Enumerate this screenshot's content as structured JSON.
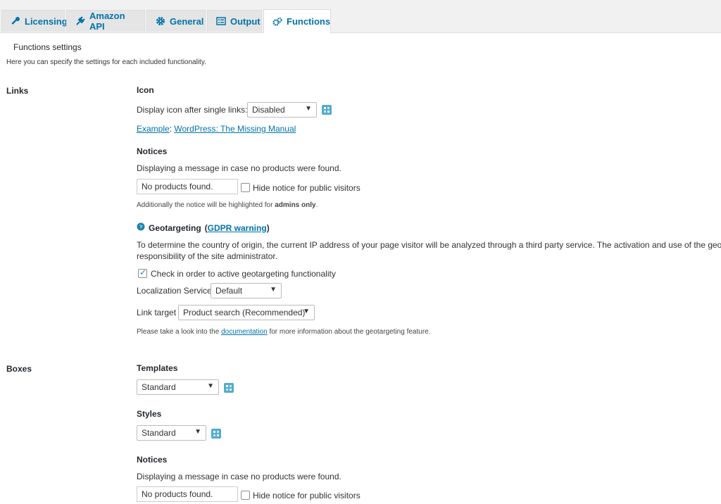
{
  "tabs": [
    {
      "label": "Licensing",
      "icon": "key-icon"
    },
    {
      "label": "Amazon API",
      "icon": "plug-icon"
    },
    {
      "label": "General",
      "icon": "gear-icon"
    },
    {
      "label": "Output",
      "icon": "list-icon"
    },
    {
      "label": "Functions",
      "icon": "gears-icon",
      "active": true
    }
  ],
  "page": {
    "heading": "Functions settings",
    "description": "Here you can specify the settings for each included functionality."
  },
  "links": {
    "section_label": "Links",
    "icon": {
      "title": "Icon",
      "display_label": "Display icon after single links:",
      "display_value": "Disabled",
      "example_label": "Example",
      "example_link": "WordPress: The Missing Manual"
    },
    "notices": {
      "title": "Notices",
      "description": "Displaying a message in case no products were found.",
      "input_value": "No products found.",
      "hide_label": "Hide notice for public visitors",
      "hide_checked": false,
      "note_prefix": "Additionally the notice will be highlighted for ",
      "note_bold": "admins only",
      "note_suffix": "."
    },
    "geotargeting": {
      "title": "Geotargeting",
      "warning_open": "(",
      "warning_link": "GDPR warning",
      "warning_close": ")",
      "description_line1": "To determine the country of origin, the current IP address of your page visitor will be analyzed through a third party service. The activation and use of the geo-ta",
      "description_line2": "responsibility of the site administrator.",
      "check_label": "Check in order to active geotargeting functionality",
      "check_checked": true,
      "service_label": "Localization Service",
      "service_value": "Default",
      "target_label": "Link target",
      "target_value": "Product search (Recommended)",
      "doc_prefix": "Please take a look into the ",
      "doc_link": "documentation",
      "doc_suffix": " for more information about the geotargeting feature."
    }
  },
  "boxes": {
    "section_label": "Boxes",
    "templates": {
      "title": "Templates",
      "value": "Standard"
    },
    "styles": {
      "title": "Styles",
      "value": "Standard"
    },
    "notices": {
      "title": "Notices",
      "description": "Displaying a message in case no products were found.",
      "input_value": "No products found.",
      "hide_label": "Hide notice for public visitors",
      "hide_checked": false
    }
  },
  "colors": {
    "link": "#0073aa",
    "help_icon": "#52accc",
    "geo_globe": "#1e7fa6"
  }
}
